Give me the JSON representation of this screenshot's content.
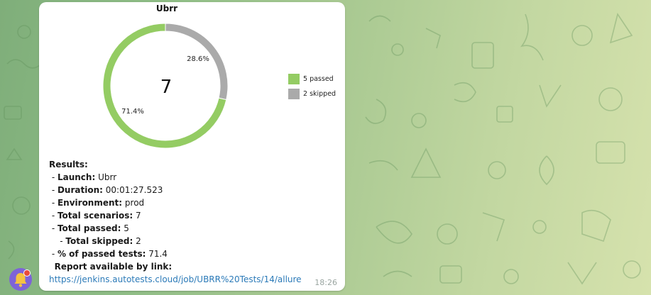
{
  "colors": {
    "passed": "#94cc63",
    "skipped": "#aaaaaa",
    "link": "#2b7ab8",
    "avatar": "#7e63d8"
  },
  "chart": {
    "title": "Ubrr",
    "center_value": "7",
    "labels": {
      "passed_pct": "71.4%",
      "skipped_pct": "28.6%"
    },
    "legend": [
      {
        "label": "5 passed",
        "color": "#94cc63"
      },
      {
        "label": "2 skipped",
        "color": "#aaaaaa"
      }
    ]
  },
  "chart_data": {
    "type": "pie",
    "title": "Ubrr",
    "categories": [
      "5 passed",
      "2 skipped"
    ],
    "values": [
      5,
      2
    ],
    "percentages": [
      71.4,
      28.6
    ],
    "total": 7,
    "donut": true,
    "legend_position": "right"
  },
  "results": {
    "heading": "Results:",
    "launch_label": "Launch:",
    "launch_value": "Ubrr",
    "duration_label": "Duration:",
    "duration_value": "00:01:27.523",
    "environment_label": "Environment:",
    "environment_value": "prod",
    "scenarios_label": "Total scenarios:",
    "scenarios_value": "7",
    "passed_label": "Total passed:",
    "passed_value": "5",
    "skipped_label": "Total skipped:",
    "skipped_value": "2",
    "pct_label": "% of passed tests:",
    "pct_value": "71.4",
    "report_label": "Report available by link:",
    "link": "https://jenkins.autotests.cloud/job/UBRR%20Tests/14/allure"
  },
  "message": {
    "time": "18:26"
  },
  "avatar": {
    "icon": "bell-icon"
  }
}
